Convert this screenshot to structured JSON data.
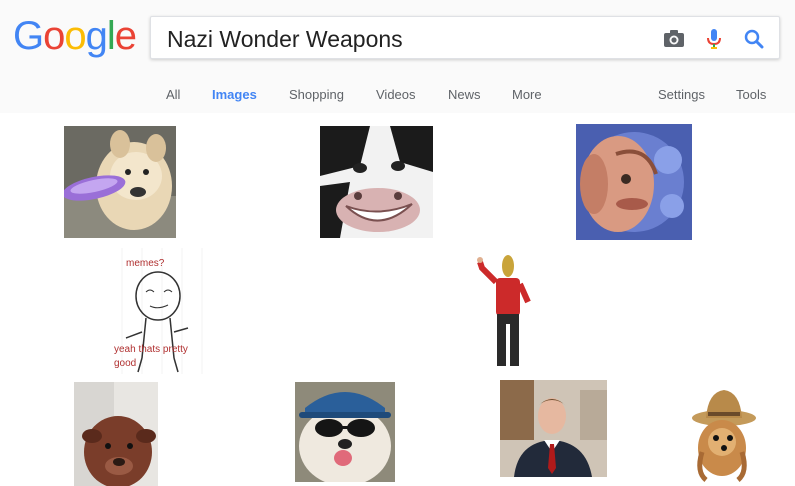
{
  "logo": {
    "letters": [
      {
        "char": "G",
        "color": "#4285F4"
      },
      {
        "char": "o",
        "color": "#EA4335"
      },
      {
        "char": "o",
        "color": "#FBBC05"
      },
      {
        "char": "g",
        "color": "#4285F4"
      },
      {
        "char": "l",
        "color": "#34A853"
      },
      {
        "char": "e",
        "color": "#EA4335"
      }
    ]
  },
  "search": {
    "query": "Nazi Wonder Weapons"
  },
  "icons": {
    "camera": "camera-icon",
    "mic": "microphone-icon",
    "search": "search-icon"
  },
  "tabs": {
    "all": "All",
    "images": "Images",
    "shopping": "Shopping",
    "videos": "Videos",
    "news": "News",
    "more": "More",
    "settings": "Settings",
    "tools": "Tools"
  },
  "accent_color": "#4285F4",
  "results": {
    "meme_text_top": "memes?",
    "meme_text_bottom_1": "yeah thats pretty",
    "meme_text_bottom_2": "good"
  }
}
